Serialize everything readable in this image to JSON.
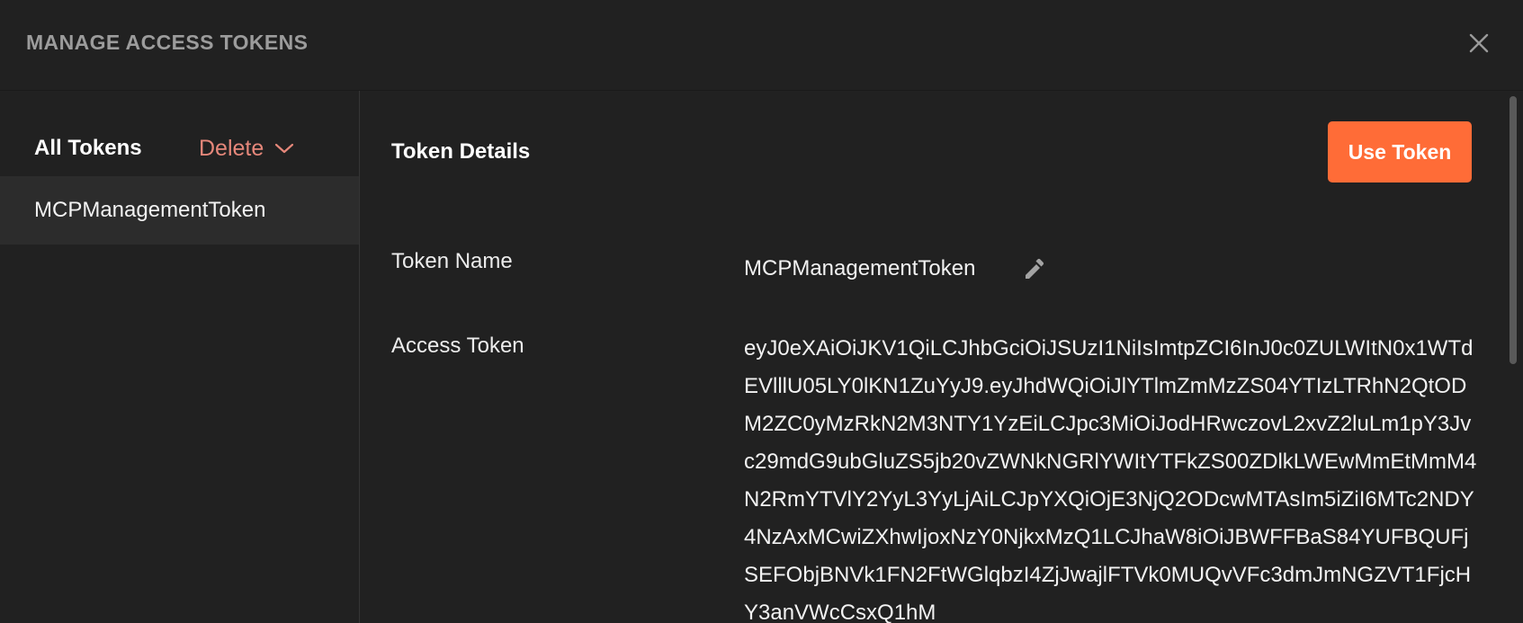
{
  "header": {
    "title": "MANAGE ACCESS TOKENS",
    "close_icon": "close-icon"
  },
  "sidebar": {
    "heading": "All Tokens",
    "delete_label": "Delete",
    "delete_icon": "chevron-down-icon",
    "items": [
      {
        "label": "MCPManagementToken",
        "selected": true
      }
    ]
  },
  "details": {
    "title": "Token Details",
    "use_token_label": "Use Token",
    "fields": {
      "token_name_label": "Token Name",
      "token_name_value": "MCPManagementToken",
      "access_token_label": "Access Token",
      "access_token_value": "eyJ0eXAiOiJKV1QiLCJhbGciOiJSUzI1NiIsImtpZCI6InJ0c0ZULWItN0x1WTdEVlllU05LY0lKN1ZuYyJ9.eyJhdWQiOiJlYTlmZmMzZS04YTIzLTRhN2QtODM2ZC0yMzRkN2M3NTY1YzEiLCJpc3MiOiJodHRwczovL2xvZ2luLm1pY3Jvc29mdG9ubGluZS5jb20vZWNkNGRlYWItYTFkZS00ZDlkLWEwMmEtMmM4N2RmYTVlY2YyL3YyLjAiLCJpYXQiOjE3NjQ2ODcwMTAsIm5iZiI6MTc2NDY4NzAxMCwiZXhwIjoxNzY0NjkxMzQ1LCJhaW8iOiJBWFFBaS84YUFBQUFjSEFObjBNVk1FN2FtWGlqbzI4ZjJwajlFTVk0MUQvVFc3dmJmNGZVT1FjcHY3anVWcCsxQ1hM"
    }
  },
  "colors": {
    "background": "#212121",
    "selected_row": "#2c2c2c",
    "accent": "#ff6c37",
    "delete_text": "#e5877a",
    "muted_title": "#9c9c9c"
  }
}
